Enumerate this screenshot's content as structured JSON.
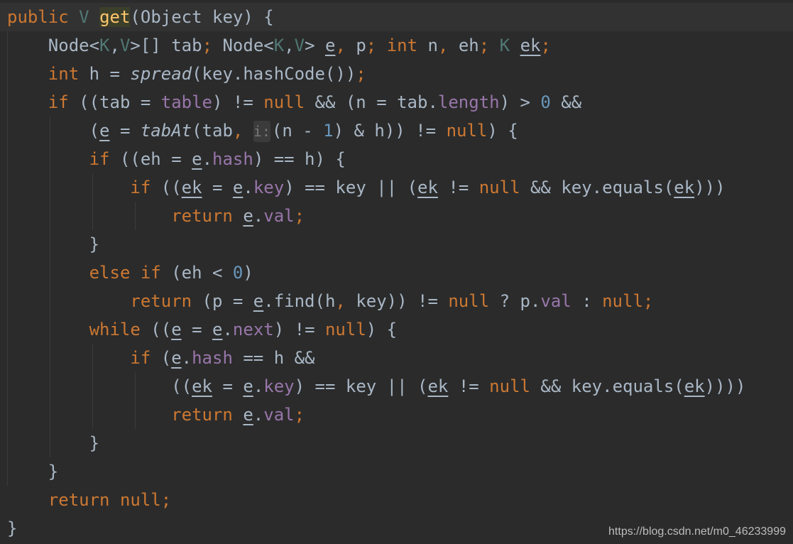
{
  "editor": {
    "language": "java",
    "theme_colors": {
      "background": "#2b2b2b",
      "keyword": "#cc7832",
      "type_param": "#507874",
      "field": "#9876aa",
      "number": "#6897bb",
      "default": "#a9b7c6"
    },
    "lines": [
      "public V get(Object key) {",
      "    Node<K,V>[] tab; Node<K,V> e, p; int n, eh; K ek;",
      "    int h = spread(key.hashCode());",
      "    if ((tab = table) != null && (n = tab.length) > 0 &&",
      "        (e = tabAt(tab, i: (n - 1) & h)) != null) {",
      "        if ((eh = e.hash) == h) {",
      "            if ((ek = e.key) == key || (ek != null && key.equals(ek)))",
      "                return e.val;",
      "        }",
      "        else if (eh < 0)",
      "            return (p = e.find(h, key)) != null ? p.val : null;",
      "        while ((e = e.next) != null) {",
      "            if (e.hash == h &&",
      "                ((ek = e.key) == key || (ek != null && key.equals(ek))))",
      "                return e.val;",
      "        }",
      "    }",
      "    return null;",
      "}"
    ],
    "inlay_hint": "i:"
  },
  "watermark": "https://blog.csdn.net/m0_46233999"
}
